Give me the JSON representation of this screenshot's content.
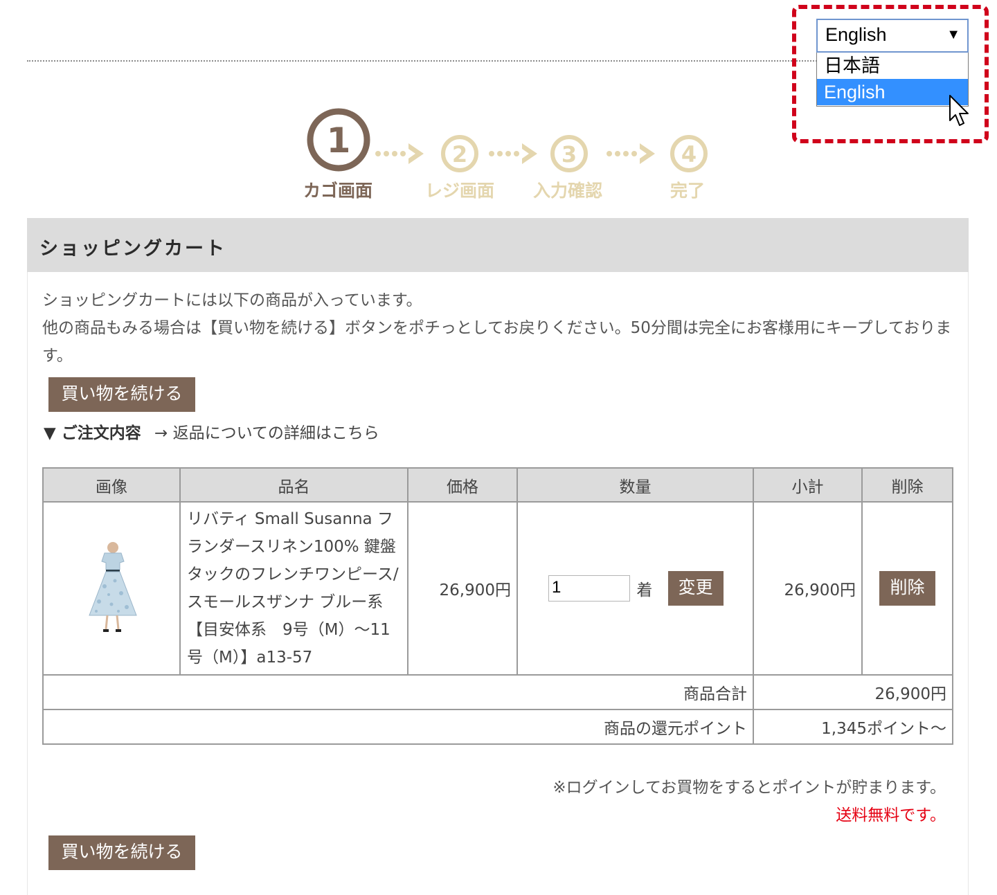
{
  "language_selector": {
    "selected": "English",
    "arrow": "▼",
    "options": [
      {
        "label": "日本語",
        "highlighted": false
      },
      {
        "label": "English",
        "highlighted": true
      }
    ],
    "highlight_color": "#d0021b"
  },
  "steps": [
    {
      "number": "1",
      "label": "カゴ画面",
      "active": true
    },
    {
      "number": "2",
      "label": "レジ画面",
      "active": false
    },
    {
      "number": "3",
      "label": "入力確認",
      "active": false
    },
    {
      "number": "4",
      "label": "完了",
      "active": false
    }
  ],
  "colors": {
    "step_active": "#7d6657",
    "step_inactive": "#e4d6ae",
    "button": "#7d6657",
    "header_bg": "#dcdcdc",
    "notice_red": "#e50012",
    "select_highlight": "#3390ff"
  },
  "panel": {
    "title": "ショッピングカート",
    "intro_line1": "ショッピングカートには以下の商品が入っています。",
    "intro_line2": "他の商品もみる場合は【買い物を続ける】ボタンをポチっとしてお戻りください。50分間は完全にお客様用にキープしております。"
  },
  "buttons": {
    "continue_shopping": "買い物を続ける",
    "change": "変更",
    "delete": "削除"
  },
  "order": {
    "heading": "▼ ご注文内容",
    "return_link": "→ 返品についての詳細はこちら"
  },
  "cart_table": {
    "headers": {
      "image": "画像",
      "name": "品名",
      "price": "価格",
      "quantity": "数量",
      "subtotal": "小計",
      "delete": "削除"
    },
    "item": {
      "image_icon": "dress-product-image",
      "name": "リバティ Small Susanna フランダースリネン100% 鍵盤タックのフレンチワンピース/スモールスザンナ ブルー系【目安体系　9号（M）～11号（M）】a13-57",
      "price": "26,900円",
      "quantity": "1",
      "unit": "着",
      "subtotal": "26,900円"
    },
    "total_label": "商品合計",
    "total_value": "26,900円",
    "points_label": "商品の還元ポイント",
    "points_value": "1,345ポイント～"
  },
  "notes": {
    "login_points": "※ログインしてお買物をするとポイントが貯まります。",
    "free_shipping": "送料無料です。"
  }
}
